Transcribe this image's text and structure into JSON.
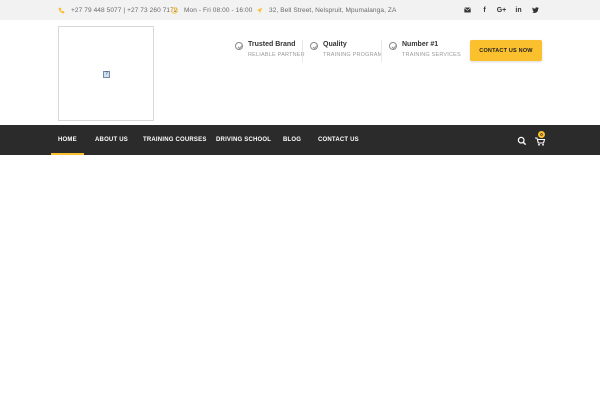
{
  "topbar": {
    "phone": "+27 79 448 5077 | +27 73 260 7172",
    "hours": "Mon - Fri 08:00 - 16:00",
    "address": "32, Bell Street, Nelspruit, Mpumalanga, ZA",
    "social": [
      "envelope-icon",
      "facebook-icon",
      "google-plus-icon",
      "linkedin-icon",
      "twitter-icon"
    ],
    "icon_color": "#fbc02d"
  },
  "header": {
    "logo_placeholder": "?",
    "features": [
      {
        "title": "Trusted Brand",
        "subtitle": "RELIABLE PARTNER"
      },
      {
        "title": "Quality",
        "subtitle": "TRAINING PROGRAM"
      },
      {
        "title": "Number #1",
        "subtitle": "TRAINING SERVICES"
      }
    ],
    "cta_label": "CONTACT US NOW"
  },
  "nav": {
    "items": [
      {
        "label": "HOME",
        "active": true
      },
      {
        "label": "ABOUT US"
      },
      {
        "label": "TRAINING COURSES"
      },
      {
        "label": "DRIVING SCHOOL"
      },
      {
        "label": "BLOG"
      },
      {
        "label": "CONTACT US"
      }
    ],
    "cart_count": "0",
    "icons": [
      "search-icon",
      "cart-icon"
    ]
  },
  "colors": {
    "accent": "#fbc02d",
    "nav_bg": "#2b2b2b",
    "topbar_bg": "#f2f2f2"
  }
}
